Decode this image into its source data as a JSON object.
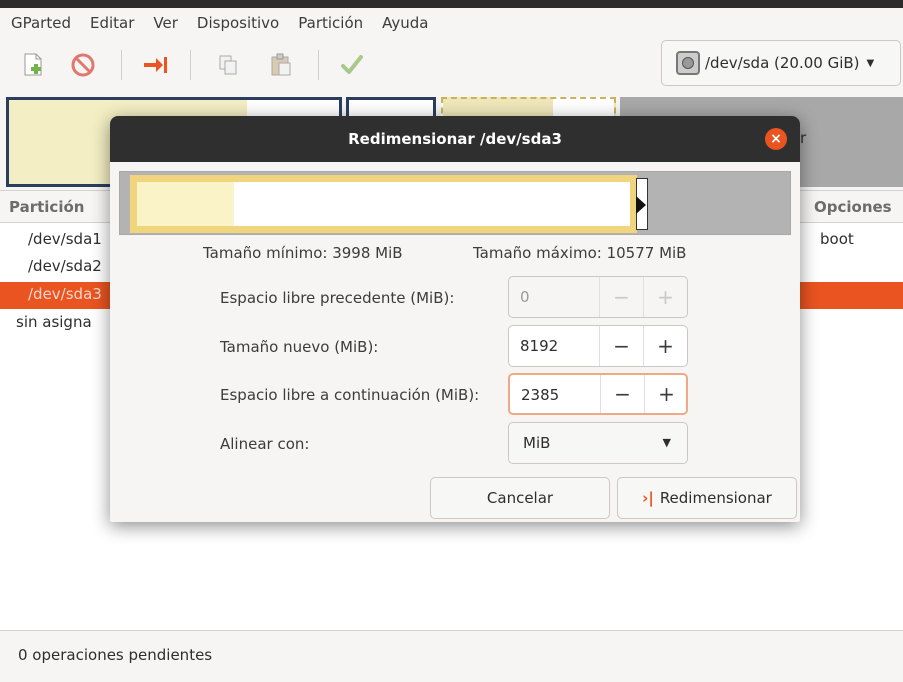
{
  "menubar": {
    "items": [
      "GParted",
      "Editar",
      "Ver",
      "Dispositivo",
      "Partición",
      "Ayuda"
    ]
  },
  "toolbar": {
    "icons": [
      "new-partition-icon",
      "delete-icon",
      "resize-move-icon",
      "copy-icon",
      "paste-icon",
      "apply-icon"
    ],
    "device_label": "/dev/sda (20.00 GiB)"
  },
  "partition_list": {
    "headers": {
      "partition": "Partición",
      "options": "Opciones"
    },
    "rows": [
      {
        "name": "/dev/sda1",
        "flag": "boot",
        "selected": false
      },
      {
        "name": "/dev/sda2",
        "flag": "",
        "selected": false
      },
      {
        "name": "/dev/sda3",
        "flag": "",
        "selected": true
      },
      {
        "name": "sin asigna",
        "flag": "",
        "selected": false
      }
    ],
    "partial_text_behind_dialog": "r"
  },
  "statusbar": {
    "text": "0 operaciones pendientes"
  },
  "dialog": {
    "title": "Redimensionar /dev/sda3",
    "min_size": "Tamaño mínimo: 3998 MiB",
    "max_size": "Tamaño máximo: 10577 MiB",
    "fields": [
      {
        "label": "Espacio libre precedente (MiB):",
        "value": "0",
        "disabled": true
      },
      {
        "label": "Tamaño nuevo (MiB):",
        "value": "8192",
        "disabled": false
      },
      {
        "label": "Espacio libre a continuación (MiB):",
        "value": "2385",
        "disabled": false,
        "focused": true
      }
    ],
    "align_label": "Alinear con:",
    "align_value": "MiB",
    "cancel_label": "Cancelar",
    "resize_label": "Redimensionar",
    "spin_minus": "−",
    "spin_plus": "+",
    "close_glyph": "×"
  },
  "colors": {
    "accent": "#e95420",
    "partition_fill": "#f0d57e",
    "title_bar": "#2f2f2f"
  }
}
